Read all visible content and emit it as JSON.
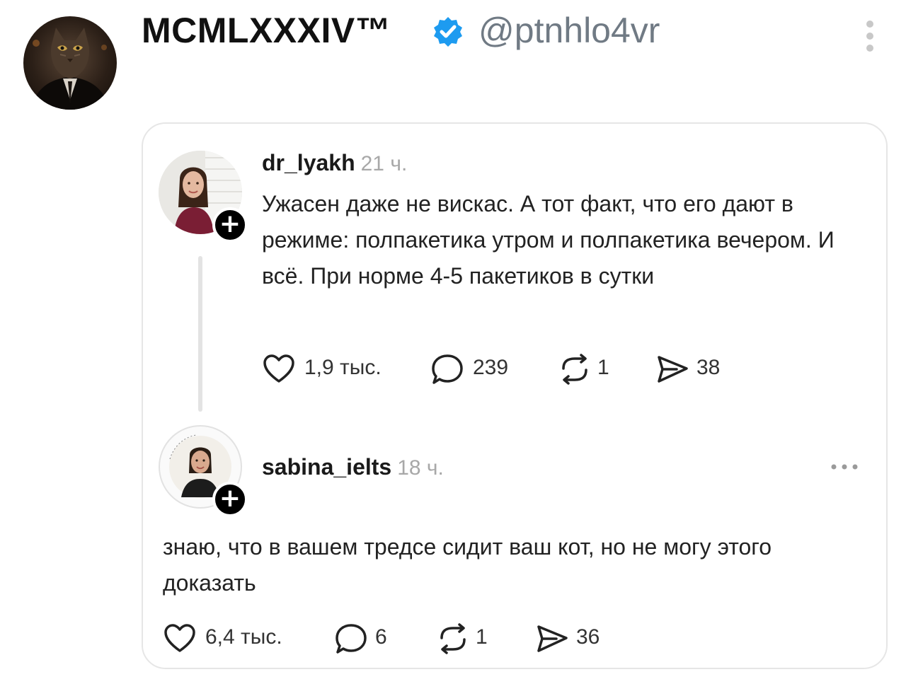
{
  "tweet": {
    "author_name": "MCMLXXXIV™",
    "author_handle": "@ptnhlo4vr",
    "verified_icon": "verified-badge-icon",
    "menu_icon": "more-vertical-icon"
  },
  "quoted_thread": {
    "comments": [
      {
        "username": "dr_lyakh",
        "time": "21 ч.",
        "text": "Ужасен даже не вискас. А тот факт, что его дают в режиме: полпакетика утром и полпакетика вечером. И всё.  При норме 4-5 пакетиков в сутки",
        "likes": "1,9 тыс.",
        "replies": "239",
        "reposts": "1",
        "shares": "38"
      },
      {
        "username": "sabina_ielts",
        "time": "18 ч.",
        "text": "знаю, что в вашем тредсе сидит ваш кот, но не могу этого доказать",
        "likes": "6,4 тыс.",
        "replies": "6",
        "reposts": "1",
        "shares": "36"
      }
    ]
  },
  "colors": {
    "verified": "#1d9bf0",
    "handle": "#707a84",
    "muted": "#a8a8a8"
  }
}
